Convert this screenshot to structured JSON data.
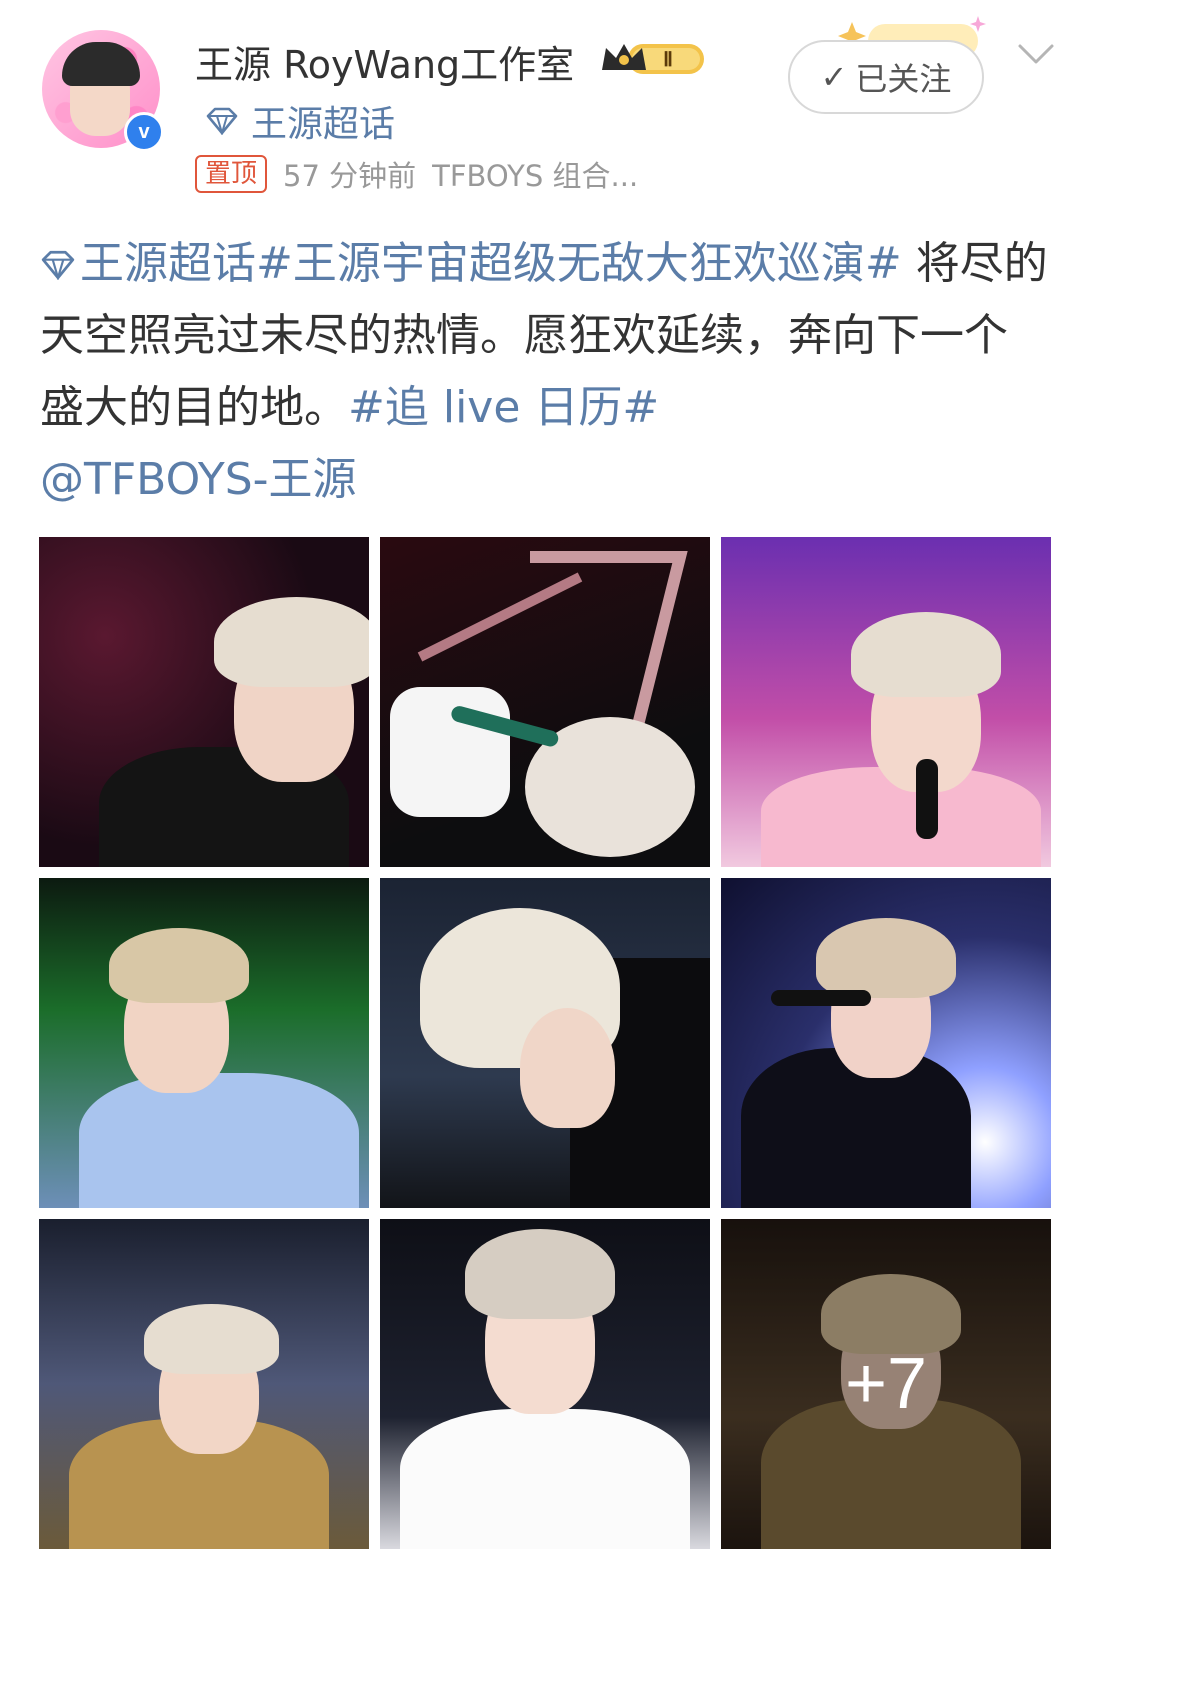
{
  "header": {
    "username": "王源 RoyWang工作室",
    "level_badge": "Ⅱ",
    "supertopic_label": "王源超话",
    "pin_tag": "置顶",
    "time_ago": "57 分钟前",
    "source": "TFBOYS 组合...",
    "follow_label": "已关注",
    "follow_check": "✓",
    "verified_mark": "v"
  },
  "post": {
    "segments": {
      "s1_topic_1": "王源超话",
      "s2_topic_2": "#王源宇宙超级无敌大狂欢巡演#",
      "s3_text_1": " 将尽的天空照亮过未尽的热情。愿狂欢延续，奔向下一个盛大的目的地。",
      "s4_topic_3": "#追 live 日历#",
      "s5_mention": "@TFBOYS-王源"
    }
  },
  "photos": {
    "more_count": "+7"
  },
  "colors": {
    "link": "#5b7da8",
    "pin": "#e0563b",
    "verified": "#2f80ed",
    "meta_gray": "#999999"
  },
  "icons": {
    "supertopic": "diamond-icon",
    "follow": "check-icon",
    "more": "chevron-down-icon",
    "verified": "verified-badge-icon",
    "level": "crown-icon"
  }
}
